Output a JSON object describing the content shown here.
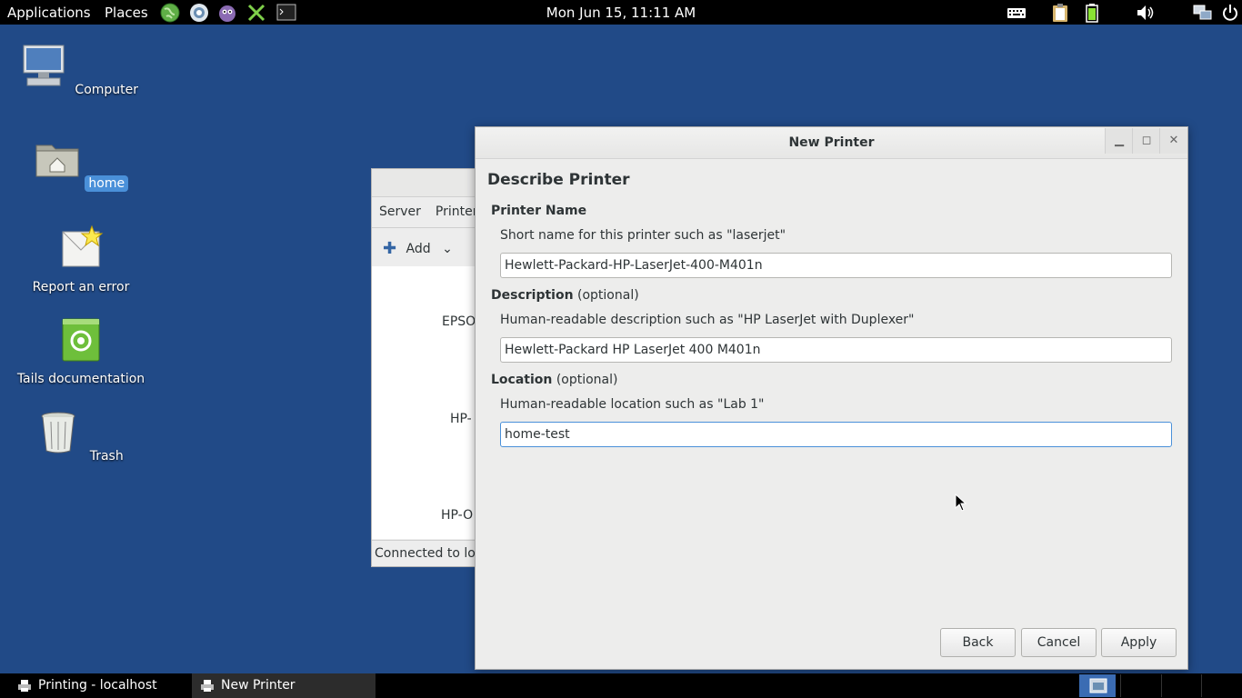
{
  "top_panel": {
    "applications": "Applications",
    "places": "Places",
    "clock": "Mon Jun 15, 11:11 AM",
    "launcher_icons": [
      "globe-icon",
      "network-icon",
      "pidgin-icon",
      "tools-icon",
      "terminal-icon"
    ],
    "tray_icons": [
      "keyboard-icon",
      "clipboard-icon",
      "battery-icon",
      "volume-icon",
      "network-status-icon",
      "power-icon"
    ]
  },
  "desktop": {
    "icons": [
      {
        "label": "Computer",
        "icon": "computer-icon"
      },
      {
        "label": "home",
        "icon": "folder-home-icon",
        "selected": true
      },
      {
        "label": "Report an error",
        "icon": "report-icon"
      },
      {
        "label": "Tails documentation",
        "icon": "documentation-icon"
      },
      {
        "label": "Trash",
        "icon": "trash-icon"
      }
    ]
  },
  "bg_window": {
    "menu": [
      "Server",
      "Printer"
    ],
    "add_label": "Add",
    "printers": [
      "EPSO",
      "HP-",
      "HP-O"
    ],
    "status": "Connected to loc"
  },
  "dialog": {
    "title": "New Printer",
    "heading": "Describe Printer",
    "printer_name": {
      "label": "Printer Name",
      "hint": "Short name for this printer such as \"laserjet\"",
      "value": "Hewlett-Packard-HP-LaserJet-400-M401n"
    },
    "description": {
      "label": "Description",
      "optional": "(optional)",
      "hint": "Human-readable description such as \"HP LaserJet with Duplexer\"",
      "value": "Hewlett-Packard HP LaserJet 400 M401n"
    },
    "location": {
      "label": "Location",
      "optional": "(optional)",
      "hint": "Human-readable location such as \"Lab 1\"",
      "value": "home-test"
    },
    "buttons": {
      "back": "Back",
      "cancel": "Cancel",
      "apply": "Apply"
    }
  },
  "taskbar": {
    "tasks": [
      {
        "label": "Printing - localhost",
        "active": false
      },
      {
        "label": "New Printer",
        "active": true
      }
    ]
  },
  "colors": {
    "desktop_bg": "#214a87",
    "panel_bg": "#000000",
    "selection": "#4a90d9",
    "dialog_bg": "#ededec"
  }
}
